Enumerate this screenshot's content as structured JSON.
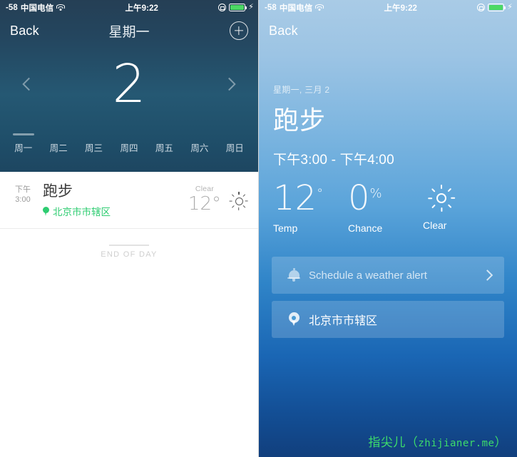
{
  "status_bar": {
    "signal": "-58",
    "carrier": "中国电信",
    "wifi_icon": "wifi-icon",
    "time": "上午9:22",
    "rotation_lock_icon": "rotation-lock-icon",
    "battery_icon": "battery-icon",
    "charging_icon": "lightning-bolt-icon",
    "battery_color": "#4cd964"
  },
  "left_screen": {
    "nav": {
      "back_label": "Back",
      "title": "星期一",
      "add_icon": "plus-circle-icon"
    },
    "day_picker": {
      "prev_icon": "chevron-left-icon",
      "day_number": "2",
      "next_icon": "chevron-right-icon"
    },
    "weekdays": [
      {
        "label": "周一",
        "selected": true
      },
      {
        "label": "周二",
        "selected": false
      },
      {
        "label": "周三",
        "selected": false
      },
      {
        "label": "周四",
        "selected": false
      },
      {
        "label": "周五",
        "selected": false
      },
      {
        "label": "周六",
        "selected": false
      },
      {
        "label": "周日",
        "selected": false
      }
    ],
    "event": {
      "time_period": "下午",
      "time_value": "3:00",
      "title": "跑步",
      "location_icon": "location-pin-icon",
      "location": "北京市市辖区",
      "location_color": "#2ecc71",
      "weather_label": "Clear",
      "temperature": "12°",
      "weather_icon": "sun-icon"
    },
    "end_of_day": "END OF DAY"
  },
  "right_screen": {
    "nav": {
      "back_label": "Back"
    },
    "date": "星期一, 三月 2",
    "title": "跑步",
    "time_range": "下午3:00 - 下午4:00",
    "stats": [
      {
        "value": "12",
        "unit": "°",
        "caption": "Temp"
      },
      {
        "value": "0",
        "unit": "%",
        "caption": "Chance"
      }
    ],
    "condition": {
      "icon": "sun-icon",
      "caption": "Clear"
    },
    "actions": [
      {
        "icon": "bell-icon",
        "label": "Schedule a weather alert",
        "chevron": "chevron-right-icon"
      },
      {
        "icon": "location-pin-icon",
        "label": "北京市市辖区",
        "chevron": ""
      }
    ]
  },
  "watermark": {
    "brand": "指尖儿（",
    "url": "zhijianer.me",
    "suffix": "）",
    "color": "#3ddc6b"
  }
}
